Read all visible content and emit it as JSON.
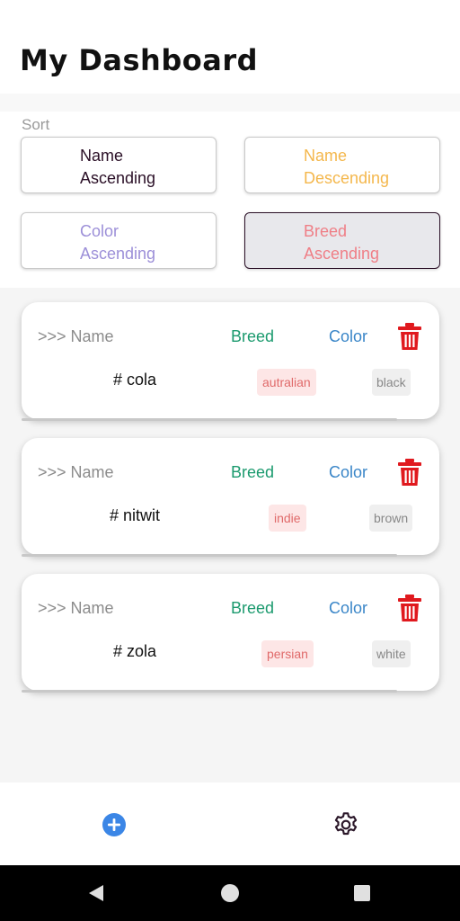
{
  "header": {
    "title": "My Dashboard"
  },
  "sort": {
    "label": "Sort",
    "buttons": [
      {
        "label": "Name\nAscending",
        "color": "#2a0f26"
      },
      {
        "label": "Name\nDescending",
        "color": "#f4b74c"
      },
      {
        "label": "Color\nAscending",
        "color": "#9c8fd8"
      },
      {
        "label": "Breed\nAscending",
        "color": "#ef7e86"
      }
    ],
    "active": "Breed Ascending"
  },
  "list_headers": {
    "name": ">>> Name",
    "breed": "Breed",
    "color": "Color"
  },
  "pets": [
    {
      "name": "# cola",
      "breed": "autralian",
      "color": "black"
    },
    {
      "name": "# nitwit",
      "breed": "indie",
      "color": "brown"
    },
    {
      "name": "# zola",
      "breed": "persian",
      "color": "white"
    }
  ],
  "icons": {
    "delete": "trash-icon",
    "add": "plus-circle-icon",
    "settings": "gear-icon",
    "sys_back": "back-triangle-icon",
    "sys_home": "home-circle-icon",
    "sys_recent": "recent-square-icon"
  },
  "colors": {
    "trash": "#e0191e",
    "add": "#3b86e6",
    "breed_header": "#1b9a6e",
    "color_header": "#3a86c8"
  }
}
